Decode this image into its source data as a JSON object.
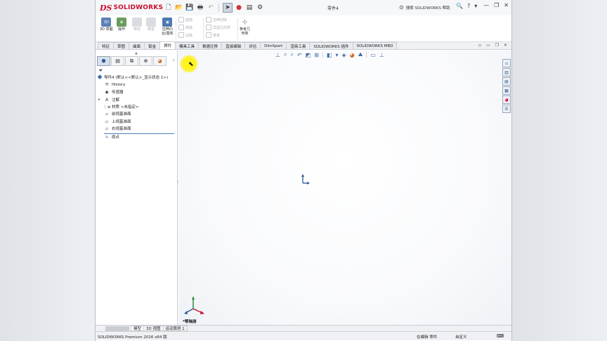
{
  "app": {
    "brand": "SOLIDWORKS",
    "brand_mark": "DS",
    "doc_title": "零件4",
    "help_search": "搜索 SOLIDWORKS 帮助"
  },
  "command_manager": {
    "big_buttons": [
      {
        "label": "3D 草图"
      },
      {
        "label": "操作"
      },
      {
        "label": "特征"
      },
      {
        "label": "类型"
      },
      {
        "label": "拉伸凸\n台/基体"
      }
    ],
    "small_col1": [
      "圆角",
      "简易",
      "边缘"
    ],
    "small_col2": [
      "拉伸切除",
      "异型孔向导",
      "参考"
    ],
    "ref_geom": "参考几\n何体"
  },
  "tabs": [
    "特征",
    "草图",
    "曲面",
    "钣金",
    "焊件",
    "模具工具",
    "数据迁移",
    "直接编辑",
    "评估",
    "DimXpert",
    "渲染工具",
    "SOLIDWORKS 插件",
    "SOLIDWORKS MBD"
  ],
  "active_tab_index": 4,
  "feature_tree": {
    "root": "零件4 (默认<<默认>_显示状态 1>)",
    "items": [
      {
        "label": "History",
        "icon": "history-icon"
      },
      {
        "label": "传感器",
        "icon": "sensor-icon"
      },
      {
        "label": "注解",
        "icon": "annotation-icon",
        "expandable": true
      },
      {
        "label": "材质 <未指定>",
        "icon": "material-icon"
      },
      {
        "label": "前视基准面",
        "icon": "plane-icon"
      },
      {
        "label": "上视基准面",
        "icon": "plane-icon"
      },
      {
        "label": "右视基准面",
        "icon": "plane-icon"
      },
      {
        "label": "原点",
        "icon": "origin-icon"
      }
    ]
  },
  "viewport": {
    "view_label": "*等轴测"
  },
  "bottom_tabs": [
    "模型",
    "3D 视图",
    "运动算例 1"
  ],
  "status": {
    "version": "SOLIDWORKS Premium 2016 x64 版",
    "editing": "在编辑 零件",
    "units": "自定义"
  },
  "colors": {
    "brand_red": "#c8102e",
    "accent_blue": "#3a6aa8"
  }
}
